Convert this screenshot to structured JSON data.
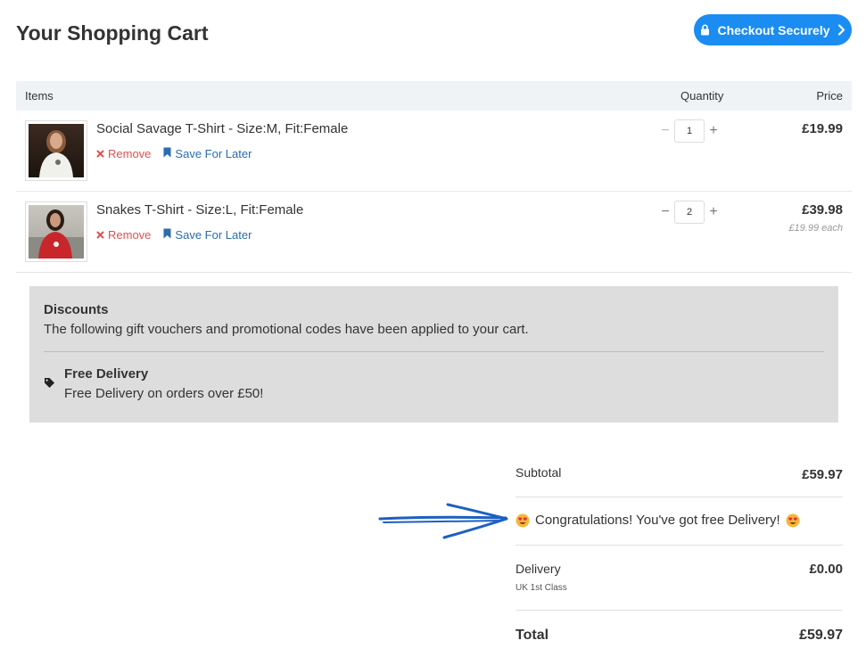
{
  "header": {
    "title": "Your Shopping Cart",
    "checkout_label": "Checkout Securely"
  },
  "table": {
    "col_items": "Items",
    "col_quantity": "Quantity",
    "col_price": "Price"
  },
  "cart": {
    "items": [
      {
        "name": "Social Savage T-Shirt - Size:M, Fit:Female",
        "remove_label": "Remove",
        "save_label": "Save For Later",
        "quantity": "1",
        "price": "£19.99",
        "each": ""
      },
      {
        "name": "Snakes T-Shirt - Size:L, Fit:Female",
        "remove_label": "Remove",
        "save_label": "Save For Later",
        "quantity": "2",
        "price": "£39.98",
        "each": "£19.99 each"
      }
    ]
  },
  "discounts": {
    "title": "Discounts",
    "text": "The following gift vouchers and promotional codes have been applied to your cart.",
    "item_title": "Free Delivery",
    "item_text": "Free Delivery on orders over £50!"
  },
  "summary": {
    "subtotal_label": "Subtotal",
    "subtotal_value": "£59.97",
    "congrats_text": "Congratulations! You've got free Delivery!",
    "delivery_label": "Delivery",
    "delivery_method": "UK 1st Class",
    "delivery_value": "£0.00",
    "total_label": "Total",
    "total_value": "£59.97"
  },
  "colors": {
    "accent": "#1a8cf2",
    "remove": "#d9534f",
    "save": "#2a6db0",
    "annotation_arrow": "#1d5fc2"
  },
  "icons": [
    "lock-icon",
    "chevron-right-icon",
    "close-icon",
    "bookmark-icon",
    "tag-icon",
    "heart-eyes-emoji-icon",
    "annotation-arrow-icon"
  ]
}
